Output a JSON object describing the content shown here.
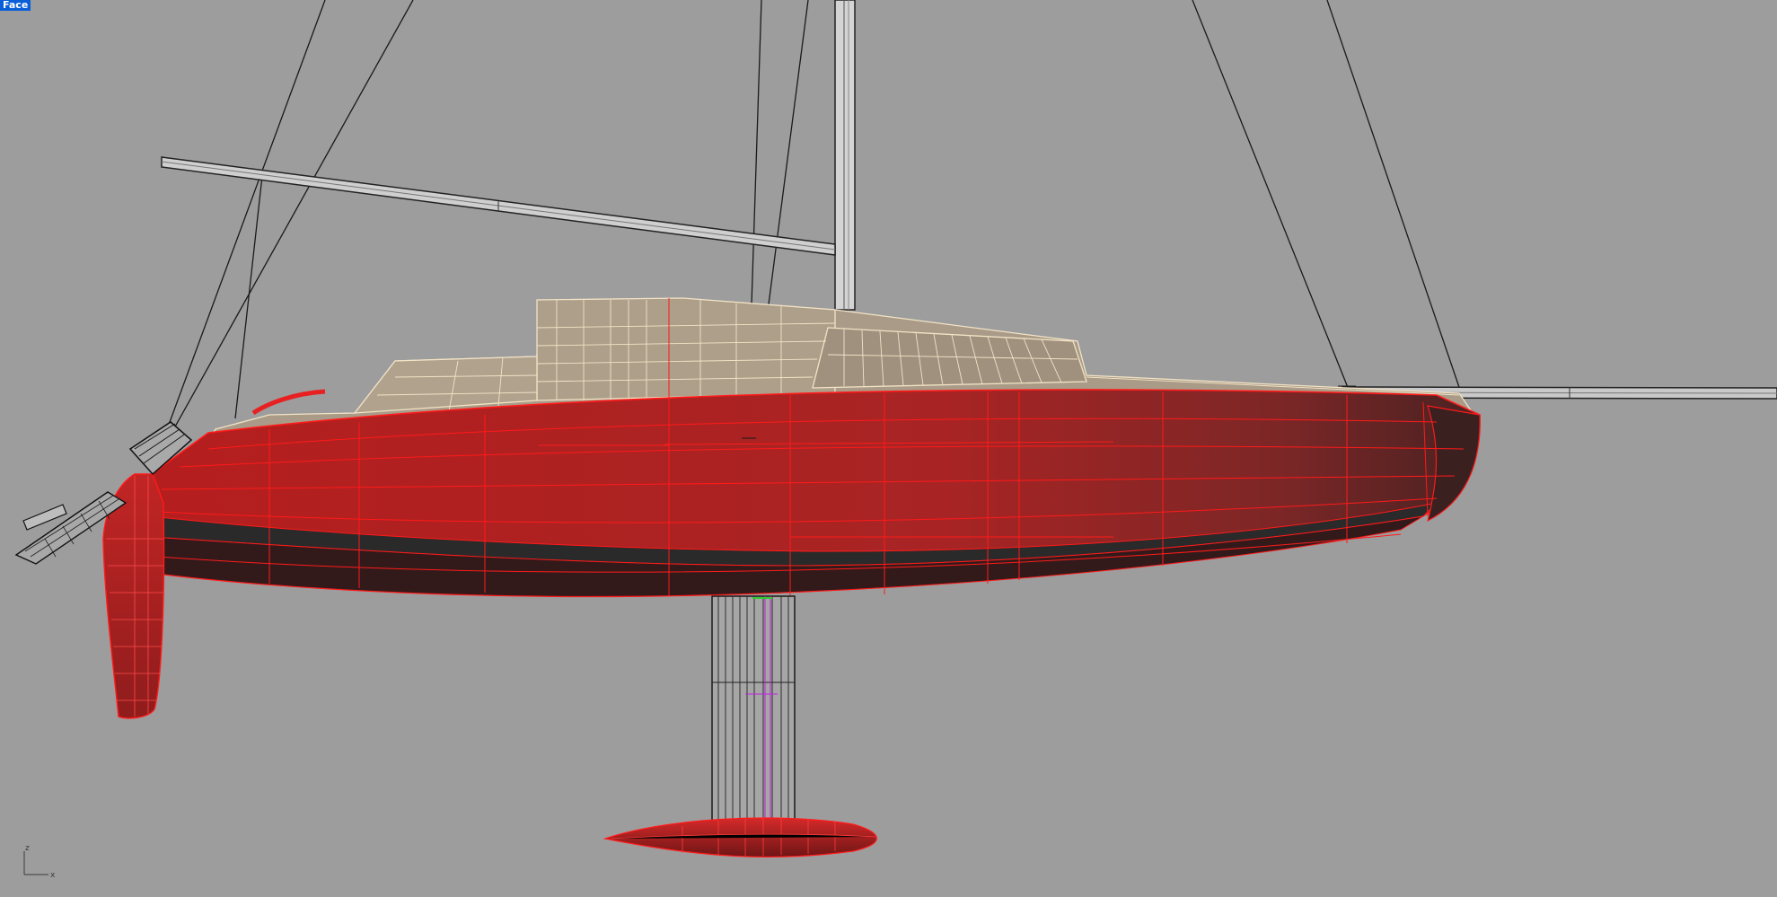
{
  "viewport": {
    "label": "Face",
    "background_color": "#9d9d9d",
    "label_background_color": "#0a5fd8",
    "axis": {
      "z_label": "z",
      "x_label": "x"
    }
  },
  "colors": {
    "hull": "#b02020",
    "hull_wire": "#ff1a1a",
    "deck": "#a89a86",
    "deck_wire": "#f2e3c6",
    "boot_stripe": "#2a2a2a",
    "rigging": "#1a1a1a"
  }
}
